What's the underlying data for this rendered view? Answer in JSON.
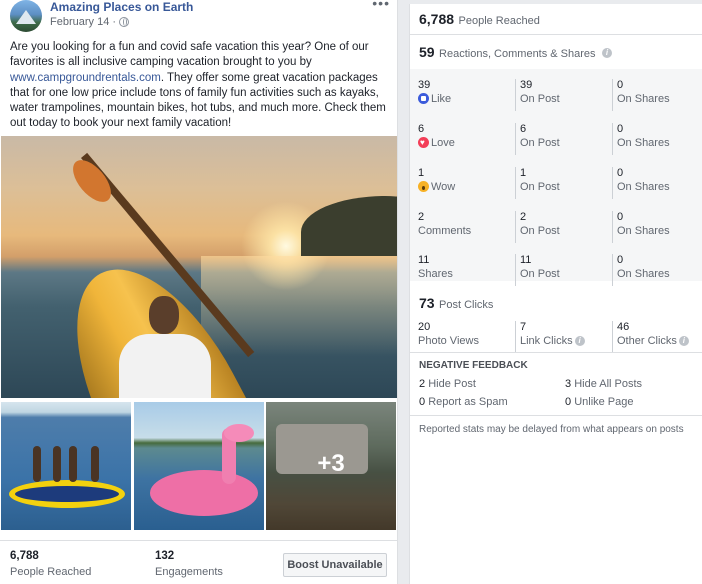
{
  "post": {
    "page_name": "Amazing Places on Earth",
    "date": "February 14 ·",
    "text_part1": "Are you looking for a fun and covid safe vacation this year? One of our favorites is all inclusive camping vacation brought to you by ",
    "link": "www.campgroundrentals.com",
    "text_part2": ". They offer some great vacation packages that for one low price include tons of family fun activities such as kayaks, water trampolines, mountain bikes, hot tubs, and much more. Check them out today to book your next family vacation!",
    "more_photos": "+3",
    "footer": {
      "reached_value": "6,788",
      "reached_label": "People Reached",
      "engagements_value": "132",
      "engagements_label": "Engagements",
      "boost_label": "Boost Unavailable"
    }
  },
  "insights": {
    "reached_value": "6,788",
    "reached_label": "People Reached",
    "reactions_value": "59",
    "reactions_label": "Reactions, Comments & Shares",
    "rows": [
      {
        "total": "39",
        "label": "Like",
        "icon": "like-icon",
        "on_post": "39",
        "on_post_label": "On Post",
        "on_shares": "0",
        "on_shares_label": "On Shares"
      },
      {
        "total": "6",
        "label": "Love",
        "icon": "love-icon",
        "on_post": "6",
        "on_post_label": "On Post",
        "on_shares": "0",
        "on_shares_label": "On Shares"
      },
      {
        "total": "1",
        "label": "Wow",
        "icon": "wow-icon",
        "on_post": "1",
        "on_post_label": "On Post",
        "on_shares": "0",
        "on_shares_label": "On Shares"
      },
      {
        "total": "2",
        "label": "Comments",
        "on_post": "2",
        "on_post_label": "On Post",
        "on_shares": "0",
        "on_shares_label": "On Shares"
      },
      {
        "total": "11",
        "label": "Shares",
        "on_post": "11",
        "on_post_label": "On Post",
        "on_shares": "0",
        "on_shares_label": "On Shares"
      }
    ],
    "clicks_value": "73",
    "clicks_label": "Post Clicks",
    "clicks": [
      {
        "value": "20",
        "label": "Photo Views"
      },
      {
        "value": "7",
        "label": "Link Clicks"
      },
      {
        "value": "46",
        "label": "Other Clicks"
      }
    ],
    "negative_title": "NEGATIVE FEEDBACK",
    "negative": [
      {
        "value": "2",
        "label": "Hide Post"
      },
      {
        "value": "3",
        "label": "Hide All Posts"
      },
      {
        "value": "0",
        "label": "Report as Spam"
      },
      {
        "value": "0",
        "label": "Unlike Page"
      }
    ],
    "note": "Reported stats may be delayed from what appears on posts"
  },
  "colors": {
    "link": "#385898",
    "grey_block": "#f5f6f7",
    "like": "#3b5bdb",
    "love": "#f33e58",
    "wow": "#f7b125"
  }
}
